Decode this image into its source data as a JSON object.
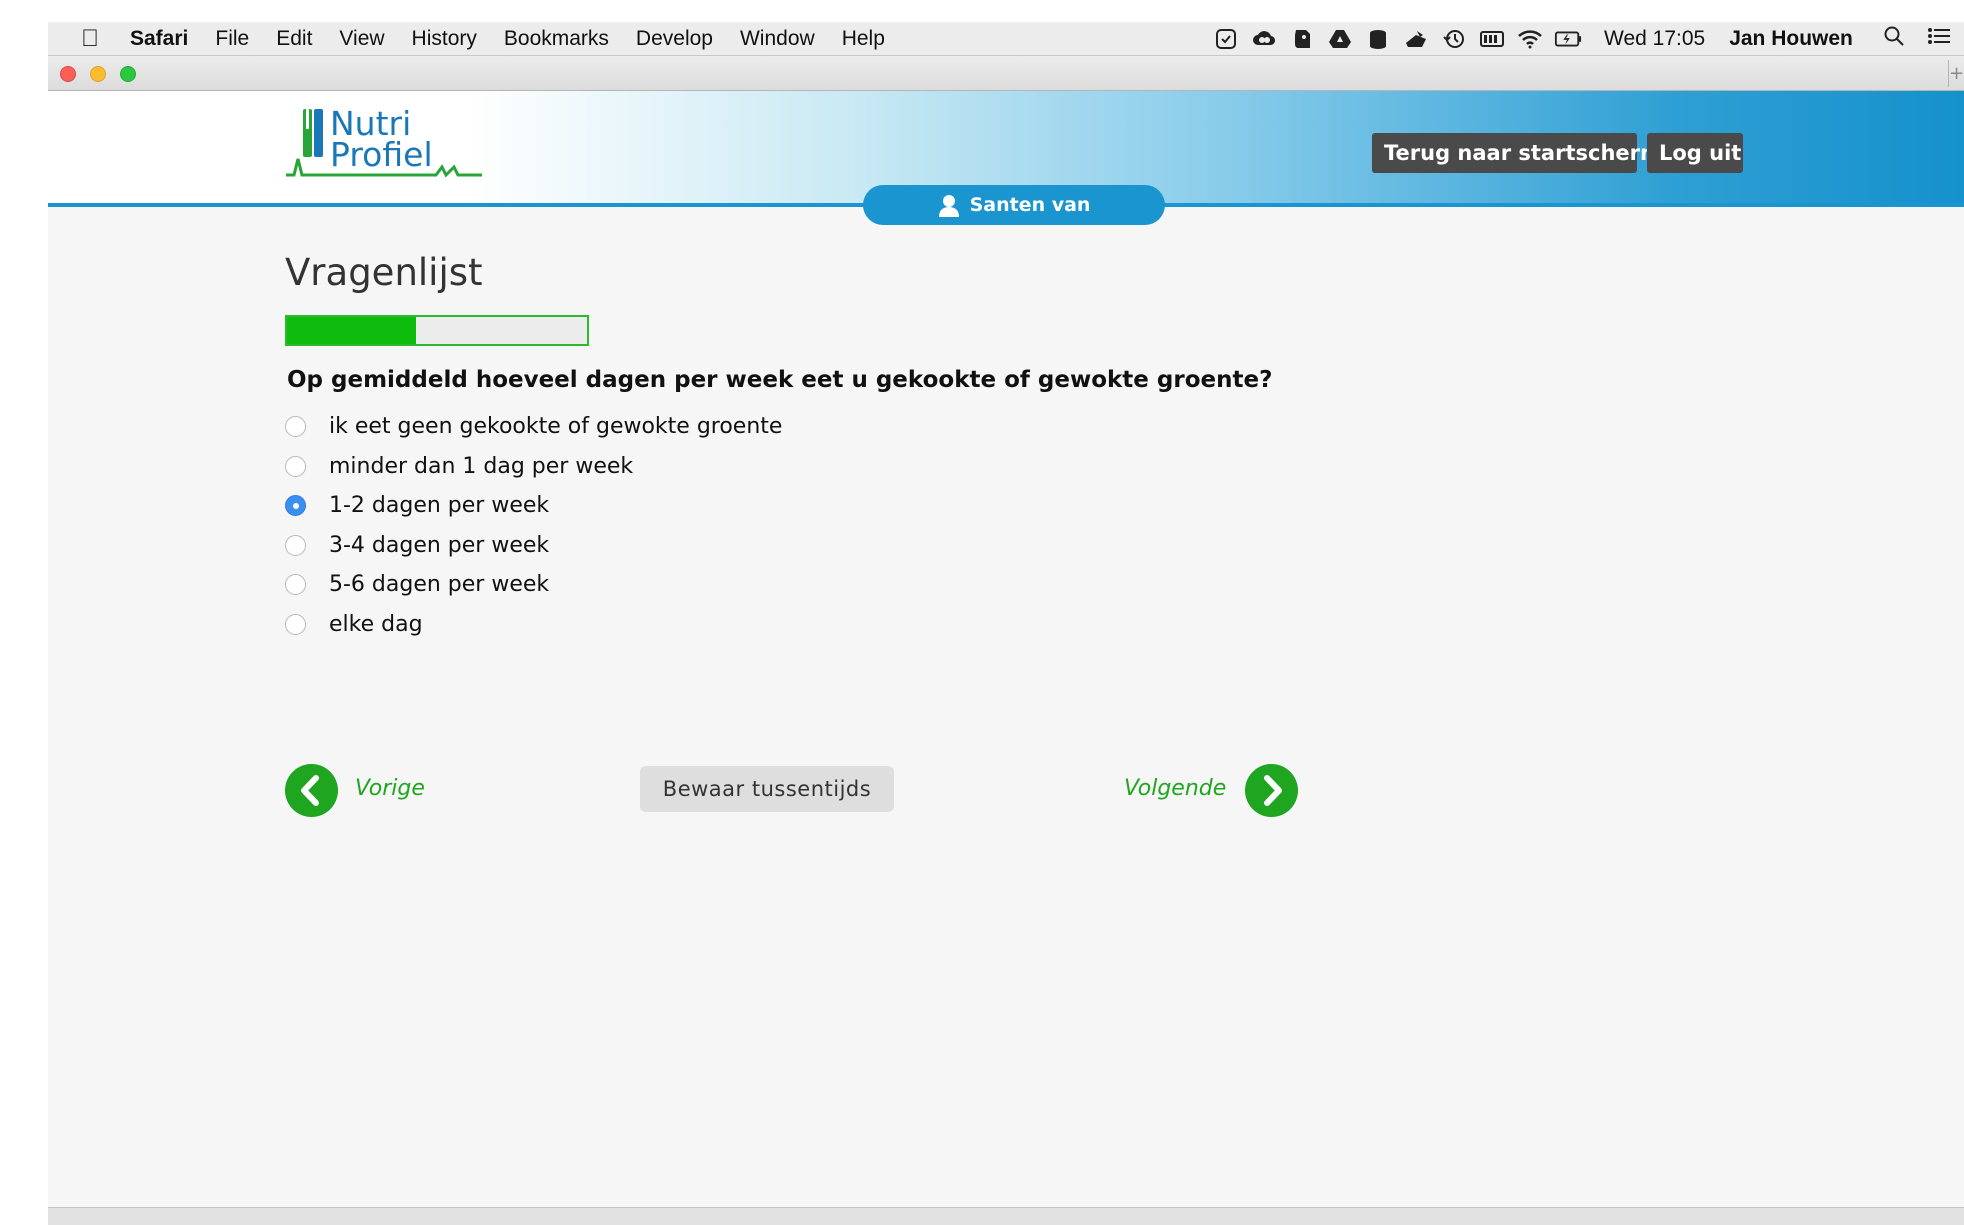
{
  "menubar": {
    "app": "Safari",
    "items": [
      "File",
      "Edit",
      "View",
      "History",
      "Bookmarks",
      "Develop",
      "Window",
      "Help"
    ],
    "status_icons": [
      "messages-icon",
      "creative-cloud-icon",
      "evernote-icon",
      "google-drive-icon",
      "backup-icon",
      "dropbox-icon",
      "time-machine-icon",
      "battery-meter-icon",
      "wifi-icon",
      "battery-icon"
    ],
    "clock": "Wed 17:05",
    "user": "Jan Houwen"
  },
  "header": {
    "logo_line1": "Nutri",
    "logo_line2": "Profiel",
    "home_button": "Terug naar startscherm",
    "logout_button": "Log uit",
    "patient_name": "Santen van",
    "accent_color": "#1a95cf"
  },
  "questionnaire": {
    "title": "Vragenlijst",
    "progress_fraction": 0.43,
    "progress_color": "#0dbc0d",
    "question": "Op gemiddeld hoeveel dagen per week eet u gekookte of gewokte groente?",
    "options": [
      {
        "label": "ik eet geen gekookte of gewokte groente",
        "checked": false
      },
      {
        "label": "minder dan 1 dag per week",
        "checked": false
      },
      {
        "label": "1-2 dagen per week",
        "checked": true
      },
      {
        "label": "3-4 dagen per week",
        "checked": false
      },
      {
        "label": "5-6 dagen per week",
        "checked": false
      },
      {
        "label": "elke dag",
        "checked": false
      }
    ]
  },
  "navigation": {
    "prev_label": "Vorige",
    "save_label": "Bewaar tussentijds",
    "next_label": "Volgende",
    "nav_color": "#1fa51f"
  }
}
